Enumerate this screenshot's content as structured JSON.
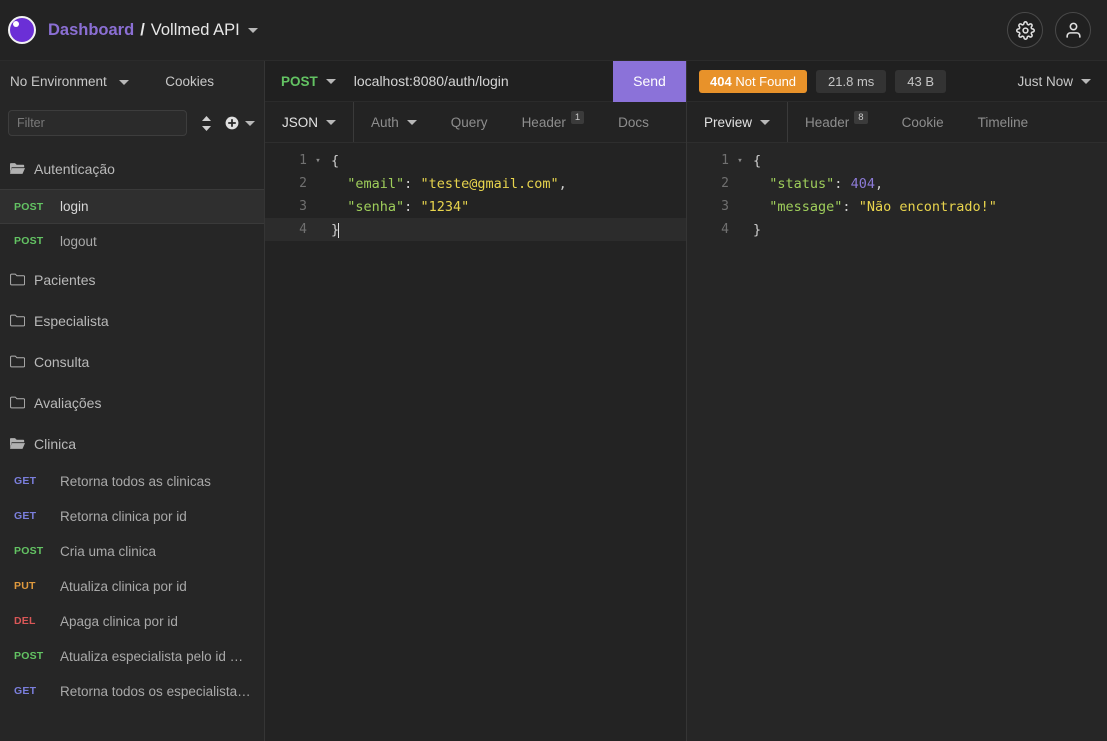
{
  "header": {
    "logo_icon": "hoppscotch-logo",
    "breadcrumb_root": "Dashboard",
    "breadcrumb_separator": "/",
    "breadcrumb_project": "Vollmed API",
    "settings_icon": "gear-icon",
    "account_icon": "user-icon"
  },
  "sidebar": {
    "environment": "No Environment",
    "cookies_label": "Cookies",
    "filter_placeholder": "Filter",
    "filter_value": "",
    "sort_icon": "sort-icon",
    "add_icon": "plus-circle-icon",
    "tree": [
      {
        "type": "folder",
        "label": "Autenticação",
        "open": true
      },
      {
        "type": "request",
        "method": "POST",
        "label": "login",
        "active": true
      },
      {
        "type": "request",
        "method": "POST",
        "label": "logout",
        "active": false
      },
      {
        "type": "folder",
        "label": "Pacientes",
        "open": false
      },
      {
        "type": "folder",
        "label": "Especialista",
        "open": false
      },
      {
        "type": "folder",
        "label": "Consulta",
        "open": false
      },
      {
        "type": "folder",
        "label": "Avaliações",
        "open": false
      },
      {
        "type": "folder",
        "label": "Clinica",
        "open": true
      },
      {
        "type": "request",
        "method": "GET",
        "label": "Retorna todos as clinicas",
        "active": false
      },
      {
        "type": "request",
        "method": "GET",
        "label": "Retorna clinica por id",
        "active": false
      },
      {
        "type": "request",
        "method": "POST",
        "label": "Cria uma clinica",
        "active": false
      },
      {
        "type": "request",
        "method": "PUT",
        "label": "Atualiza clinica por id",
        "active": false
      },
      {
        "type": "request",
        "method": "DEL",
        "label": "Apaga clinica por id",
        "active": false
      },
      {
        "type": "request",
        "method": "POST",
        "label": "Atualiza especialista pelo id …",
        "active": false
      },
      {
        "type": "request",
        "method": "GET",
        "label": "Retorna todos os especialista…",
        "active": false
      }
    ]
  },
  "request": {
    "method": "POST",
    "url": "localhost:8080/auth/login",
    "send_label": "Send",
    "tabs": [
      {
        "label": "JSON",
        "active": true,
        "caret": true,
        "badge": ""
      },
      {
        "label": "Auth",
        "active": false,
        "caret": true,
        "badge": ""
      },
      {
        "label": "Query",
        "active": false,
        "caret": false,
        "badge": ""
      },
      {
        "label": "Header",
        "active": false,
        "caret": false,
        "badge": "1"
      },
      {
        "label": "Docs",
        "active": false,
        "caret": false,
        "badge": ""
      }
    ],
    "body_lines": [
      {
        "n": "1",
        "fold": "▾",
        "active": false,
        "tokens": [
          {
            "t": "{",
            "c": "punc"
          }
        ]
      },
      {
        "n": "2",
        "fold": "",
        "active": false,
        "tokens": [
          {
            "t": "  ",
            "c": "punc"
          },
          {
            "t": "\"email\"",
            "c": "key"
          },
          {
            "t": ": ",
            "c": "punc"
          },
          {
            "t": "\"teste@gmail.com\"",
            "c": "str"
          },
          {
            "t": ",",
            "c": "punc"
          }
        ]
      },
      {
        "n": "3",
        "fold": "",
        "active": false,
        "tokens": [
          {
            "t": "  ",
            "c": "punc"
          },
          {
            "t": "\"senha\"",
            "c": "key"
          },
          {
            "t": ": ",
            "c": "punc"
          },
          {
            "t": "\"1234\"",
            "c": "str"
          }
        ]
      },
      {
        "n": "4",
        "fold": "",
        "active": true,
        "tokens": [
          {
            "t": "}",
            "c": "punc"
          }
        ]
      }
    ]
  },
  "response": {
    "status_code": "404",
    "status_text": "Not Found",
    "duration": "21.8 ms",
    "size": "43 B",
    "timestamp": "Just Now",
    "tabs": [
      {
        "label": "Preview",
        "active": true,
        "caret": true,
        "badge": ""
      },
      {
        "label": "Header",
        "active": false,
        "caret": false,
        "badge": "8"
      },
      {
        "label": "Cookie",
        "active": false,
        "caret": false,
        "badge": ""
      },
      {
        "label": "Timeline",
        "active": false,
        "caret": false,
        "badge": ""
      }
    ],
    "body_lines": [
      {
        "n": "1",
        "fold": "▾",
        "active": false,
        "tokens": [
          {
            "t": "{",
            "c": "punc"
          }
        ]
      },
      {
        "n": "2",
        "fold": "",
        "active": false,
        "tokens": [
          {
            "t": "  ",
            "c": "punc"
          },
          {
            "t": "\"status\"",
            "c": "key"
          },
          {
            "t": ": ",
            "c": "punc"
          },
          {
            "t": "404",
            "c": "num"
          },
          {
            "t": ",",
            "c": "punc"
          }
        ]
      },
      {
        "n": "3",
        "fold": "",
        "active": false,
        "tokens": [
          {
            "t": "  ",
            "c": "punc"
          },
          {
            "t": "\"message\"",
            "c": "key"
          },
          {
            "t": ": ",
            "c": "punc"
          },
          {
            "t": "\"Não encontrado!\"",
            "c": "str"
          }
        ]
      },
      {
        "n": "4",
        "fold": "",
        "active": false,
        "tokens": [
          {
            "t": "}",
            "c": "punc"
          }
        ]
      }
    ]
  },
  "colors": {
    "accent": "#8b72d9",
    "status_404": "#e8922a",
    "method_get": "#7b7fdc",
    "method_post": "#63c363",
    "method_put": "#e09a3e",
    "method_del": "#d95757",
    "json_key": "#9fce5b",
    "json_string": "#e8d44d",
    "json_number": "#8d7bd8"
  }
}
